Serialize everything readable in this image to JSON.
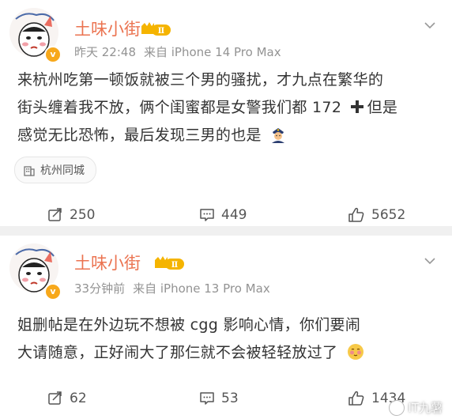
{
  "posts": [
    {
      "username": "土味小街",
      "level": "Ⅱ",
      "time": "昨天 22:48",
      "source": "来自 iPhone 14 Pro Max",
      "text_lines": [
        "来杭州吃第一顿饭就被三个男的骚扰，才九点在繁华的",
        "街头缠着我不放，俩个闺蜜都是女警我们都 172",
        "感觉无比恐怖，最后发现三男的也是"
      ],
      "after_plus": "但是",
      "emoji_end": "police-officer-emoji",
      "location_tag": "杭州同城",
      "reposts": "250",
      "comments": "449",
      "likes": "5652"
    },
    {
      "username": "土味小街",
      "level": "Ⅱ",
      "time": "33分钟前",
      "source": "来自 iPhone 13 Pro Max",
      "text_lines": [
        "姐删帖是在外边玩不想被 cgg 影响心情，你们要闹",
        "大请随意，正好闹大了那仨就不会被轻轻放过了"
      ],
      "emoji_end": "shy-face-emoji",
      "reposts": "62",
      "comments": "53",
      "likes": "1434"
    }
  ],
  "watermark": "IT九薯",
  "colors": {
    "username": "#eb7350",
    "meta": "#939393",
    "text": "#333333",
    "verified_badge": "#f7a81b"
  }
}
